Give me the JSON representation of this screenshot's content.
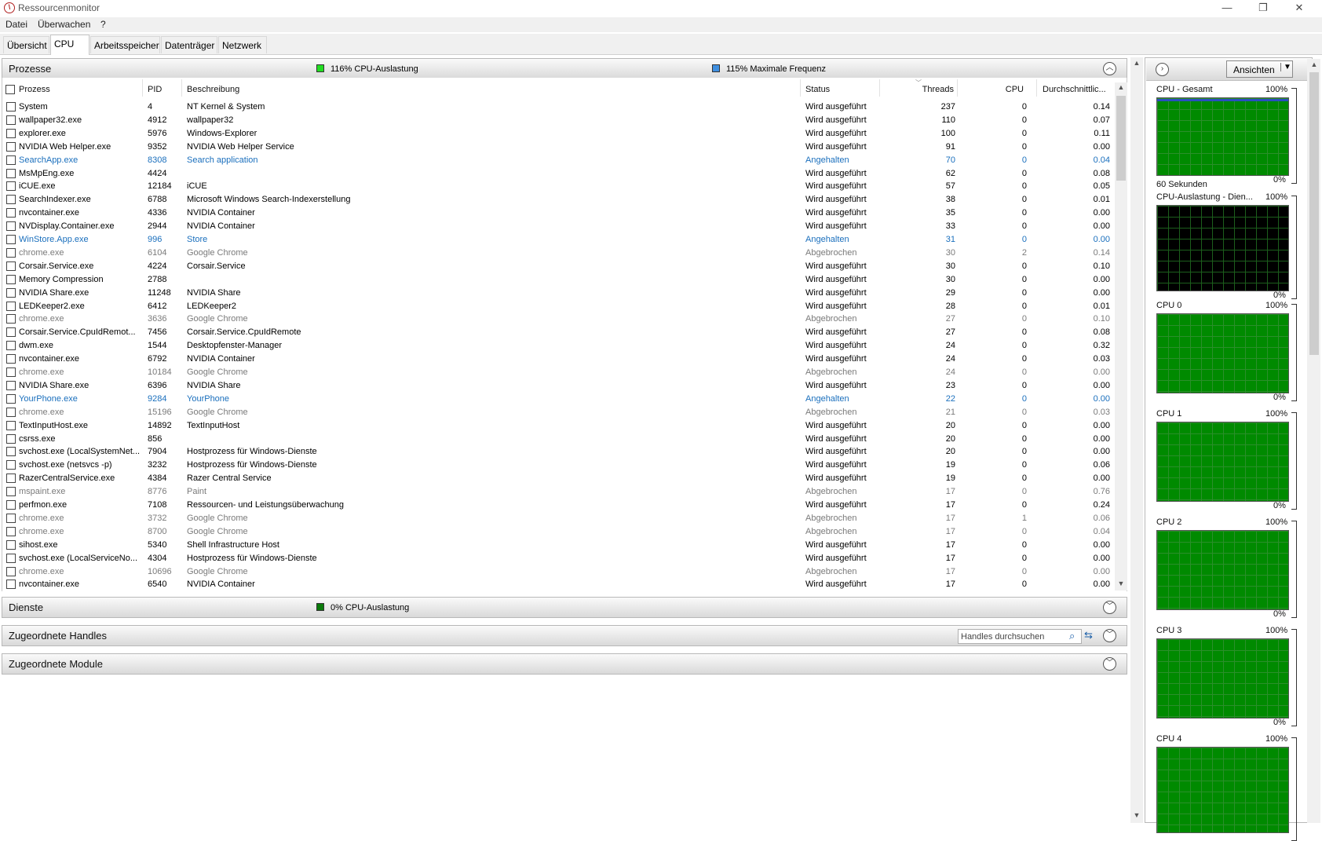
{
  "window": {
    "title": "Ressourcenmonitor",
    "minimize": "—",
    "maximize": "❐",
    "close": "✕"
  },
  "menu": [
    "Datei",
    "Überwachen",
    "?"
  ],
  "tabs": [
    "Übersicht",
    "CPU",
    "Arbeitsspeicher",
    "Datenträger",
    "Netzwerk"
  ],
  "active_tab": "CPU",
  "processes": {
    "title": "Prozesse",
    "usage_label": "116% CPU-Auslastung",
    "usage_color": "#22dd22",
    "freq_label": "115% Maximale Frequenz",
    "freq_color": "#3f8fe0",
    "columns": [
      "Prozess",
      "PID",
      "Beschreibung",
      "Status",
      "Threads",
      "CPU",
      "Durchschnittlic..."
    ],
    "rows": [
      [
        "System",
        "4",
        "NT Kernel & System",
        "Wird ausgeführt",
        "237",
        "0",
        "0.14"
      ],
      [
        "wallpaper32.exe",
        "4912",
        "wallpaper32",
        "Wird ausgeführt",
        "110",
        "0",
        "0.07"
      ],
      [
        "explorer.exe",
        "5976",
        "Windows-Explorer",
        "Wird ausgeführt",
        "100",
        "0",
        "0.11"
      ],
      [
        "NVIDIA Web Helper.exe",
        "9352",
        "NVIDIA Web Helper Service",
        "Wird ausgeführt",
        "91",
        "0",
        "0.00"
      ],
      [
        "SearchApp.exe",
        "8308",
        "Search application",
        "Angehalten",
        "70",
        "0",
        "0.04"
      ],
      [
        "MsMpEng.exe",
        "4424",
        "",
        "Wird ausgeführt",
        "62",
        "0",
        "0.08"
      ],
      [
        "iCUE.exe",
        "12184",
        "iCUE",
        "Wird ausgeführt",
        "57",
        "0",
        "0.05"
      ],
      [
        "SearchIndexer.exe",
        "6788",
        "Microsoft Windows Search-Indexerstellung",
        "Wird ausgeführt",
        "38",
        "0",
        "0.01"
      ],
      [
        "nvcontainer.exe",
        "4336",
        "NVIDIA Container",
        "Wird ausgeführt",
        "35",
        "0",
        "0.00"
      ],
      [
        "NVDisplay.Container.exe",
        "2944",
        "NVIDIA Container",
        "Wird ausgeführt",
        "33",
        "0",
        "0.00"
      ],
      [
        "WinStore.App.exe",
        "996",
        "Store",
        "Angehalten",
        "31",
        "0",
        "0.00"
      ],
      [
        "chrome.exe",
        "6104",
        "Google Chrome",
        "Abgebrochen",
        "30",
        "2",
        "0.14"
      ],
      [
        "Corsair.Service.exe",
        "4224",
        "Corsair.Service",
        "Wird ausgeführt",
        "30",
        "0",
        "0.10"
      ],
      [
        "Memory Compression",
        "2788",
        "",
        "Wird ausgeführt",
        "30",
        "0",
        "0.00"
      ],
      [
        "NVIDIA Share.exe",
        "11248",
        "NVIDIA Share",
        "Wird ausgeführt",
        "29",
        "0",
        "0.00"
      ],
      [
        "LEDKeeper2.exe",
        "6412",
        "LEDKeeper2",
        "Wird ausgeführt",
        "28",
        "0",
        "0.01"
      ],
      [
        "chrome.exe",
        "3636",
        "Google Chrome",
        "Abgebrochen",
        "27",
        "0",
        "0.10"
      ],
      [
        "Corsair.Service.CpuIdRemot...",
        "7456",
        "Corsair.Service.CpuIdRemote",
        "Wird ausgeführt",
        "27",
        "0",
        "0.08"
      ],
      [
        "dwm.exe",
        "1544",
        "Desktopfenster-Manager",
        "Wird ausgeführt",
        "24",
        "0",
        "0.32"
      ],
      [
        "nvcontainer.exe",
        "6792",
        "NVIDIA Container",
        "Wird ausgeführt",
        "24",
        "0",
        "0.03"
      ],
      [
        "chrome.exe",
        "10184",
        "Google Chrome",
        "Abgebrochen",
        "24",
        "0",
        "0.00"
      ],
      [
        "NVIDIA Share.exe",
        "6396",
        "NVIDIA Share",
        "Wird ausgeführt",
        "23",
        "0",
        "0.00"
      ],
      [
        "YourPhone.exe",
        "9284",
        "YourPhone",
        "Angehalten",
        "22",
        "0",
        "0.00"
      ],
      [
        "chrome.exe",
        "15196",
        "Google Chrome",
        "Abgebrochen",
        "21",
        "0",
        "0.03"
      ],
      [
        "TextInputHost.exe",
        "14892",
        "TextInputHost",
        "Wird ausgeführt",
        "20",
        "0",
        "0.00"
      ],
      [
        "csrss.exe",
        "856",
        "",
        "Wird ausgeführt",
        "20",
        "0",
        "0.00"
      ],
      [
        "svchost.exe (LocalSystemNet...",
        "7904",
        "Hostprozess für Windows-Dienste",
        "Wird ausgeführt",
        "20",
        "0",
        "0.00"
      ],
      [
        "svchost.exe (netsvcs -p)",
        "3232",
        "Hostprozess für Windows-Dienste",
        "Wird ausgeführt",
        "19",
        "0",
        "0.06"
      ],
      [
        "RazerCentralService.exe",
        "4384",
        "Razer Central Service",
        "Wird ausgeführt",
        "19",
        "0",
        "0.00"
      ],
      [
        "mspaint.exe",
        "8776",
        "Paint",
        "Abgebrochen",
        "17",
        "0",
        "0.76"
      ],
      [
        "perfmon.exe",
        "7108",
        "Ressourcen- und Leistungsüberwachung",
        "Wird ausgeführt",
        "17",
        "0",
        "0.24"
      ],
      [
        "chrome.exe",
        "3732",
        "Google Chrome",
        "Abgebrochen",
        "17",
        "1",
        "0.06"
      ],
      [
        "chrome.exe",
        "8700",
        "Google Chrome",
        "Abgebrochen",
        "17",
        "0",
        "0.04"
      ],
      [
        "sihost.exe",
        "5340",
        "Shell Infrastructure Host",
        "Wird ausgeführt",
        "17",
        "0",
        "0.00"
      ],
      [
        "svchost.exe (LocalServiceNo...",
        "4304",
        "Hostprozess für Windows-Dienste",
        "Wird ausgeführt",
        "17",
        "0",
        "0.00"
      ],
      [
        "chrome.exe",
        "10696",
        "Google Chrome",
        "Abgebrochen",
        "17",
        "0",
        "0.00"
      ],
      [
        "nvcontainer.exe",
        "6540",
        "NVIDIA Container",
        "Wird ausgeführt",
        "17",
        "0",
        "0.00"
      ]
    ]
  },
  "services": {
    "title": "Dienste",
    "usage_label": "0% CPU-Auslastung",
    "usage_color": "#0a7a0a"
  },
  "handles": {
    "title": "Zugeordnete Handles",
    "search_placeholder": "Handles durchsuchen"
  },
  "modules": {
    "title": "Zugeordnete Module"
  },
  "side_panel": {
    "views_button": "Ansichten",
    "graphs": [
      {
        "title": "CPU - Gesamt",
        "max": "100%",
        "footer_left": "60 Sekunden",
        "footer_right": "0%"
      },
      {
        "title": "CPU-Auslastung - Dien...",
        "max": "100%",
        "footer_left": "",
        "footer_right": "0%"
      },
      {
        "title": "CPU 0",
        "max": "100%",
        "footer_left": "",
        "footer_right": "0%"
      },
      {
        "title": "CPU 1",
        "max": "100%",
        "footer_left": "",
        "footer_right": "0%"
      },
      {
        "title": "CPU 2",
        "max": "100%",
        "footer_left": "",
        "footer_right": "0%"
      },
      {
        "title": "CPU 3",
        "max": "100%",
        "footer_left": "",
        "footer_right": "0%"
      },
      {
        "title": "CPU 4",
        "max": "100%",
        "footer_left": "",
        "footer_right": ""
      }
    ]
  }
}
